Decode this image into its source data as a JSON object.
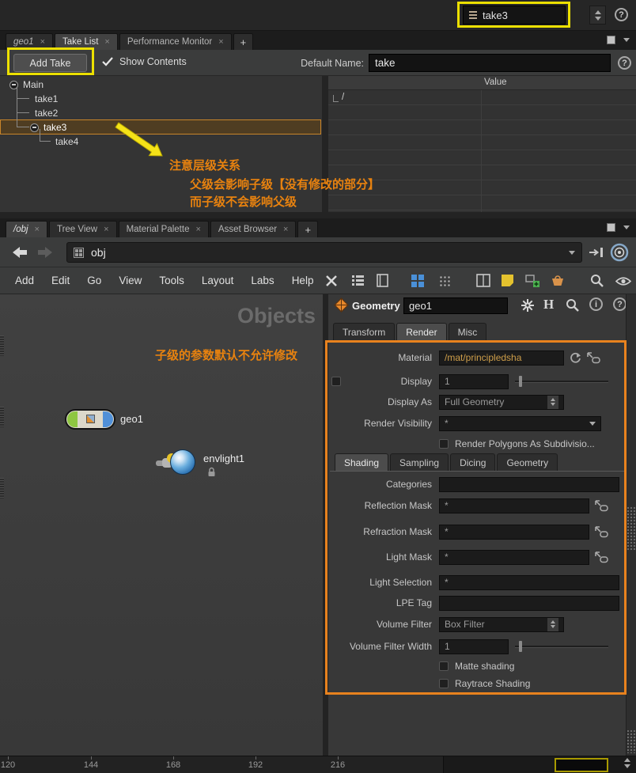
{
  "glyphs": {
    "close": "×",
    "plus": "+",
    "help": "?",
    "info": "i",
    "logo_h": "H"
  },
  "colors": {
    "highlight_yellow": "#ece000",
    "annotation_orange": "#e8820f",
    "param_box_orange": "#e8821e",
    "take_selection_orange": "#c8842a"
  },
  "topbar": {
    "take_value": "take3"
  },
  "pane_top": {
    "tabs": [
      {
        "label": "geo1"
      },
      {
        "label": "Take List"
      },
      {
        "label": "Performance Monitor"
      }
    ],
    "toolbar": {
      "add_take_label": "Add Take",
      "show_contents_label": "Show Contents",
      "default_name_label": "Default Name:",
      "default_name_value": "take"
    },
    "take_tree": {
      "root_label": "Main",
      "take1": "take1",
      "take2": "take2",
      "take3": "take3",
      "take4": "take4"
    },
    "value_table": {
      "value_header": "Value",
      "root_path": "/"
    },
    "annotation": {
      "line1": "注意层级关系",
      "line2": "父级会影响子级【没有修改的部分】",
      "line3": "而子级不会影响父级"
    }
  },
  "pane_network": {
    "tabs": [
      {
        "label": "/obj"
      },
      {
        "label": "Tree View"
      },
      {
        "label": "Material Palette"
      },
      {
        "label": "Asset Browser"
      }
    ],
    "path_value": "obj",
    "menus": [
      "Add",
      "Edit",
      "Go",
      "View",
      "Tools",
      "Layout",
      "Labs",
      "Help"
    ],
    "watermark": "Objects",
    "annotation": "子级的参数默认不允许修改",
    "nodes": [
      {
        "label": "geo1"
      },
      {
        "label": "envlight1"
      }
    ]
  },
  "params": {
    "header": {
      "type_label": "Geometry",
      "name_value": "geo1"
    },
    "tabs": [
      "Transform",
      "Render",
      "Misc"
    ],
    "material": {
      "label": "Material",
      "value": "/mat/principledsha"
    },
    "display": {
      "label": "Display",
      "value": "1"
    },
    "display_as": {
      "label": "Display As",
      "value": "Full Geometry"
    },
    "render_visibility": {
      "label": "Render Visibility",
      "value": "*"
    },
    "render_polygons_label": "Render Polygons As Subdivisio...",
    "subtabs": [
      "Shading",
      "Sampling",
      "Dicing",
      "Geometry"
    ],
    "categories": {
      "label": "Categories",
      "value": ""
    },
    "reflection_mask": {
      "label": "Reflection Mask",
      "value": "*"
    },
    "refraction_mask": {
      "label": "Refraction Mask",
      "value": "*"
    },
    "light_mask": {
      "label": "Light Mask",
      "value": "*"
    },
    "light_selection": {
      "label": "Light Selection",
      "value": "*"
    },
    "lpe_tag": {
      "label": "LPE Tag",
      "value": ""
    },
    "volume_filter": {
      "label": "Volume Filter",
      "value": "Box Filter"
    },
    "volume_filter_width": {
      "label": "Volume Filter Width",
      "value": "1"
    },
    "matte_shading_label": "Matte shading",
    "raytrace_shading_label": "Raytrace Shading"
  },
  "timeline": {
    "ticks": [
      "120",
      "144",
      "168",
      "192",
      "216"
    ]
  }
}
